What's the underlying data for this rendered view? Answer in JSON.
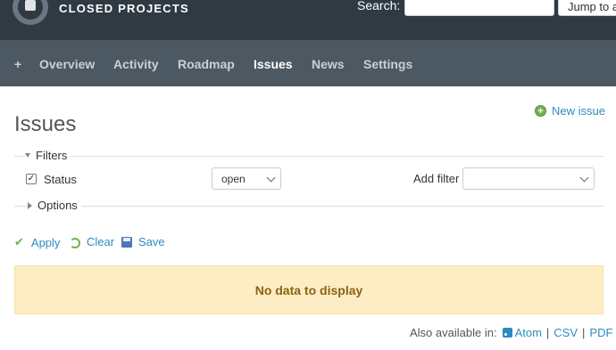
{
  "header": {
    "project_title": "CLOSED PROJECTS",
    "search_label": "Search:",
    "search_value": "",
    "jump_label": "Jump to a"
  },
  "nav": {
    "items": [
      {
        "label": "+"
      },
      {
        "label": "Overview"
      },
      {
        "label": "Activity"
      },
      {
        "label": "Roadmap"
      },
      {
        "label": "Issues",
        "active": true
      },
      {
        "label": "News"
      },
      {
        "label": "Settings"
      }
    ]
  },
  "main": {
    "title": "Issues",
    "new_issue_label": "New issue",
    "filters_legend": "Filters",
    "status_label": "Status",
    "status_checked": true,
    "status_value": "open",
    "add_filter_label": "Add filter",
    "add_filter_value": "",
    "options_legend": "Options",
    "apply_label": "Apply",
    "clear_label": "Clear",
    "save_label": "Save",
    "no_data_text": "No data to display",
    "also_available_label": "Also available in:",
    "export_atom": "Atom",
    "export_csv": "CSV",
    "export_pdf": "PDF",
    "separator": "|"
  },
  "colors": {
    "header_bg": "#2f3a43",
    "nav_bg": "#4c5963",
    "link": "#2e8bc0",
    "nodata_bg": "#fdedc4",
    "nodata_text": "#8a6412",
    "accent_green": "#6fb24f"
  },
  "icons": {
    "logo": "logo-icon",
    "new_issue": "add-icon",
    "apply": "checkmark-icon",
    "clear": "reload-icon",
    "save": "save-icon",
    "atom": "rss-icon"
  }
}
